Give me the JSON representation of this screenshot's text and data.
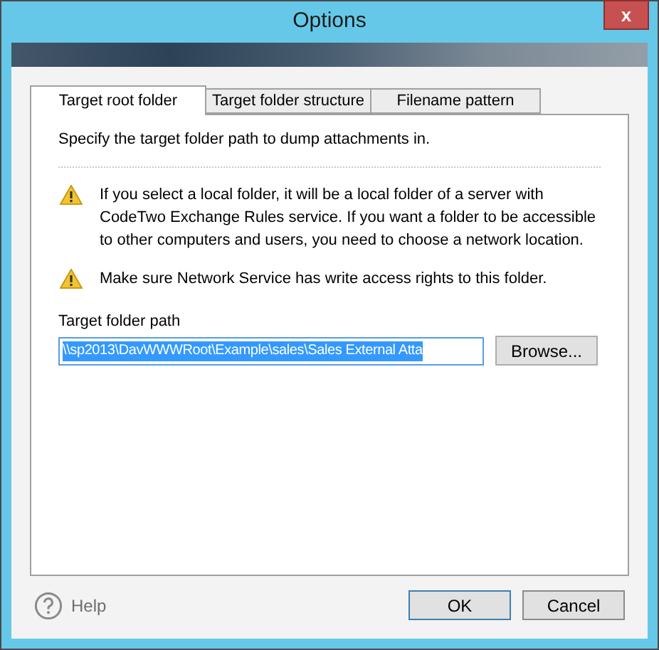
{
  "window": {
    "title": "Options",
    "close": "x"
  },
  "tabs": [
    {
      "label": "Target root folder",
      "selected": true
    },
    {
      "label": "Target folder structure",
      "selected": false
    },
    {
      "label": "Filename pattern",
      "selected": false
    }
  ],
  "intro": "Specify the target folder path to dump attachments in.",
  "warnings": [
    "If you select a local folder, it will be a local folder of a server with CodeTwo Exchange Rules service. If you want a folder to be accessible to other computers and users, you need to choose a network location.",
    "Make sure Network Service has write access rights to this folder."
  ],
  "path_field": {
    "label": "Target folder path",
    "value": "\\\\sp2013\\DavWWWRoot\\Example\\sales\\Sales External Atta",
    "text_selected": true
  },
  "browse_button": "Browse...",
  "help": "Help",
  "buttons": [
    {
      "label": "OK",
      "default": true
    },
    {
      "label": "Cancel",
      "default": false
    }
  ]
}
